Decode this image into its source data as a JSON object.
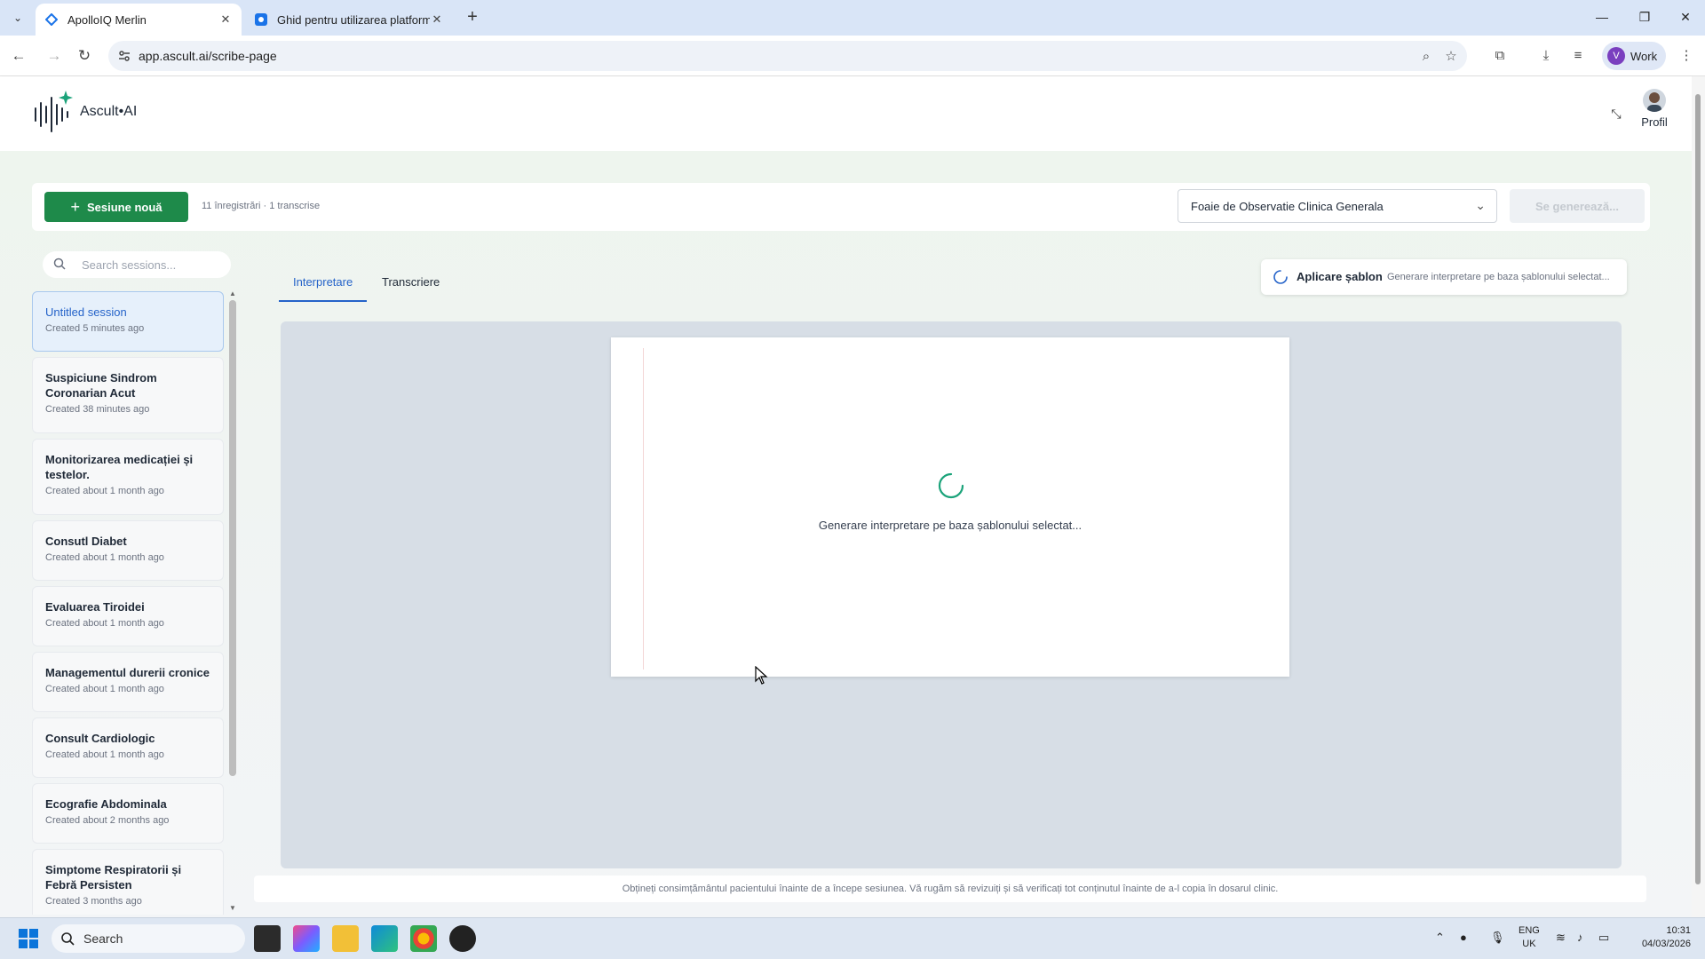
{
  "browser": {
    "tabs": [
      {
        "title": "ApolloIQ Merlin",
        "active": true
      },
      {
        "title": "Ghid pentru utilizarea platform",
        "active": false
      }
    ],
    "url": "app.ascult.ai/scribe-page",
    "profile_label": "Work",
    "profile_initial": "V"
  },
  "app": {
    "brand": "Ascult•AI",
    "profile_label": "Profil"
  },
  "session_bar": {
    "new_button": "Sesiune nouă",
    "counts": "11 înregistrări · 1 transcrise",
    "template": "Foaie de Observatie Clinica Generala",
    "generate_button": "Se generează..."
  },
  "sidebar": {
    "search_placeholder": "Search sessions...",
    "sessions": [
      {
        "title": "Untitled session",
        "meta": "Created 5 minutes ago",
        "active": true
      },
      {
        "title": "Suspiciune Sindrom Coronarian Acut",
        "meta": "Created 38 minutes ago"
      },
      {
        "title": "Monitorizarea medicației și testelor.",
        "meta": "Created about 1 month ago"
      },
      {
        "title": "Consutl Diabet",
        "meta": "Created about 1 month ago"
      },
      {
        "title": "Evaluarea Tiroidei",
        "meta": "Created about 1 month ago"
      },
      {
        "title": "Managementul durerii cronice",
        "meta": "Created about 1 month ago"
      },
      {
        "title": "Consult Cardiologic",
        "meta": "Created about 1 month ago"
      },
      {
        "title": "Ecografie Abdominala",
        "meta": "Created about 2 months ago"
      },
      {
        "title": "Simptome Respiratorii și Febră Persisten",
        "meta": "Created 3 months ago"
      }
    ]
  },
  "main": {
    "tabs": [
      "Interpretare",
      "Transcriere"
    ],
    "active_tab": "Interpretare",
    "toast_title": "Aplicare șablon",
    "toast_text": "Generare interpretare pe baza șablonului selectat...",
    "loading_text": "Generare interpretare pe baza șablonului selectat...",
    "disclaimer": "Obțineți consimțământul pacientului înainte de a începe sesiunea. Vă rugăm să revizuiți și să verificați tot conținutul înainte de a-l copia în dosarul clinic."
  },
  "taskbar": {
    "search_label": "Search",
    "lang_top": "ENG",
    "lang_bottom": "UK",
    "time": "10:31",
    "date": "04/03/2026"
  },
  "colors": {
    "primary_green": "#1e8a4a",
    "accent_blue": "#2563c9",
    "spinner_teal": "#1ba37a"
  }
}
